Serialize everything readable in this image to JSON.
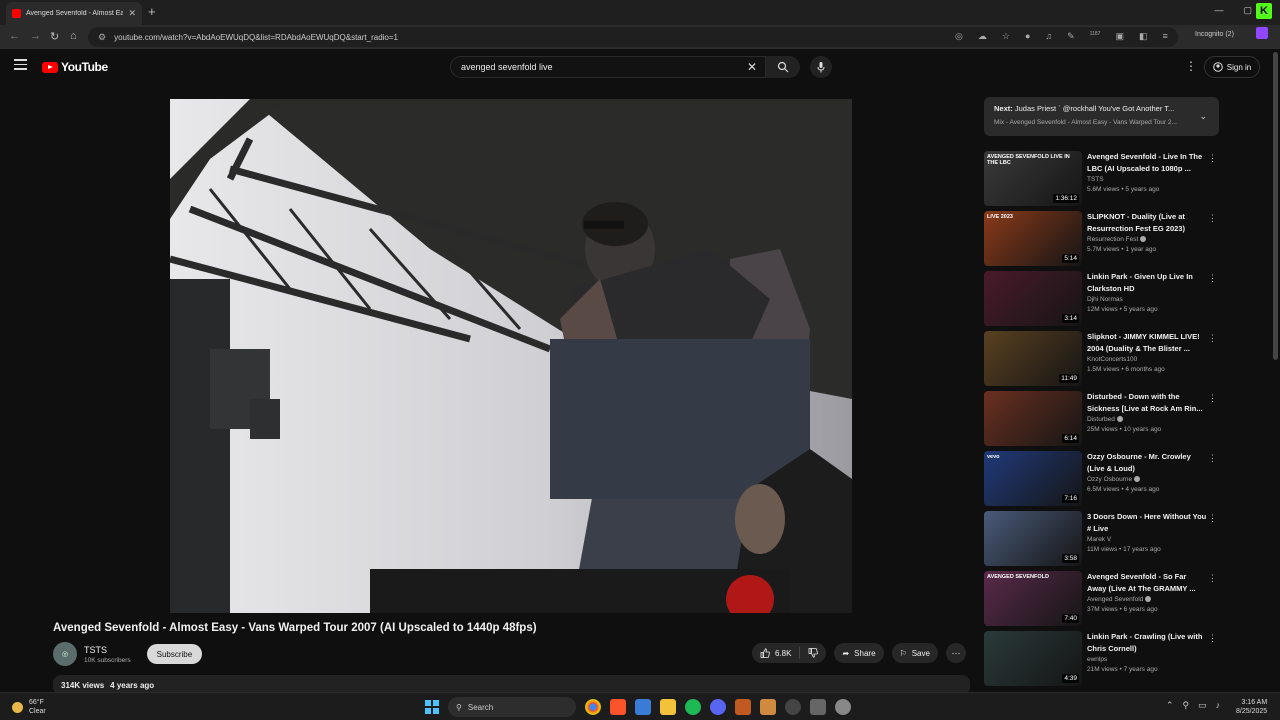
{
  "browser": {
    "tab_title": "Avenged Sevenfold - Almost Easy",
    "url": "youtube.com/watch?v=AbdAoEWUqDQ&list=RDAbdAoEWUqDQ&start_radio=1",
    "incognito_label": "Incognito (2)",
    "ext_badge": "1187"
  },
  "youtube": {
    "logo_text": "YouTube",
    "search_value": "avenged sevenfold live",
    "signin_label": "Sign in"
  },
  "video": {
    "title": "Avenged Sevenfold - Almost Easy - Vans Warped Tour 2007 (AI Upscaled to 1440p 48fps)",
    "channel": "TSTS",
    "subscribers": "10K subscribers",
    "subscribe_label": "Subscribe",
    "likes": "6.8K",
    "share_label": "Share",
    "save_label": "Save",
    "views": "314K views",
    "age": "4 years ago"
  },
  "up_next": {
    "prefix": "Next:",
    "title": "Judas Priest ` @rockhall You've Got Another T...",
    "mix": "Mix - Avenged Sevenfold - Almost Easy - Vans Warped Tour 2..."
  },
  "recommendations": [
    {
      "title": "Avenged Sevenfold - Live In The LBC (AI Upscaled to 1080p ...",
      "channel": "TSTS",
      "verified": false,
      "stats": "5.6M views • 5 years ago",
      "duration": "1:36:12",
      "thumb_label": "AVENGED SEVENFOLD LIVE IN THE LBC",
      "thumb_color": "#3a3a3a"
    },
    {
      "title": "SLIPKNOT - Duality (Live at Resurrection Fest EG 2023)",
      "channel": "Resurrection Fest",
      "verified": true,
      "stats": "5.7M views • 1 year ago",
      "duration": "5:14",
      "thumb_label": "LIVE 2023",
      "thumb_color": "#8a3a1a"
    },
    {
      "title": "Linkin Park - Given Up Live In Clarkston HD",
      "channel": "Djhi Normas",
      "verified": false,
      "stats": "12M views • 5 years ago",
      "duration": "3:14",
      "thumb_label": "",
      "thumb_color": "#4a1a2a"
    },
    {
      "title": "Slipknot - JIMMY KIMMEL LIVE! 2004 (Duality & The Blister ...",
      "channel": "KnotConcerts100",
      "verified": false,
      "stats": "1.5M views • 6 months ago",
      "duration": "11:49",
      "thumb_label": "",
      "thumb_color": "#5a4020"
    },
    {
      "title": "Disturbed - Down with the Sickness [Live at Rock Am Rin...",
      "channel": "Disturbed",
      "verified": true,
      "stats": "25M views • 10 years ago",
      "duration": "6:14",
      "thumb_label": "",
      "thumb_color": "#6a3020"
    },
    {
      "title": "Ozzy Osbourne - Mr. Crowley (Live & Loud)",
      "channel": "Ozzy Osbourne",
      "verified": true,
      "stats": "6.5M views • 4 years ago",
      "duration": "7:16",
      "thumb_label": "vevo",
      "thumb_color": "#203a7a"
    },
    {
      "title": "3 Doors Down - Here Without You # Live",
      "channel": "Marek V",
      "verified": false,
      "stats": "11M views • 17 years ago",
      "duration": "3:58",
      "thumb_label": "",
      "thumb_color": "#4a5a7a"
    },
    {
      "title": "Avenged Sevenfold - So Far Away (Live At The GRAMMY ...",
      "channel": "Avenged Sevenfold",
      "verified": true,
      "stats": "37M views • 6 years ago",
      "duration": "7:40",
      "thumb_label": "AVENGED SEVENFOLD",
      "thumb_color": "#5a2a4a"
    },
    {
      "title": "Linkin Park - Crawling (Live with Chris Cornell)",
      "channel": "ewnlps",
      "verified": false,
      "stats": "21M views • 7 years ago",
      "duration": "4:39",
      "thumb_label": "",
      "thumb_color": "#2a3a3a"
    }
  ],
  "taskbar": {
    "temp": "66°F",
    "weather": "Clear",
    "search_label": "Search",
    "time": "3:16 AM",
    "date": "8/25/2025"
  },
  "colors": {
    "accent": "#ff0000",
    "bg": "#0f0f0f"
  }
}
